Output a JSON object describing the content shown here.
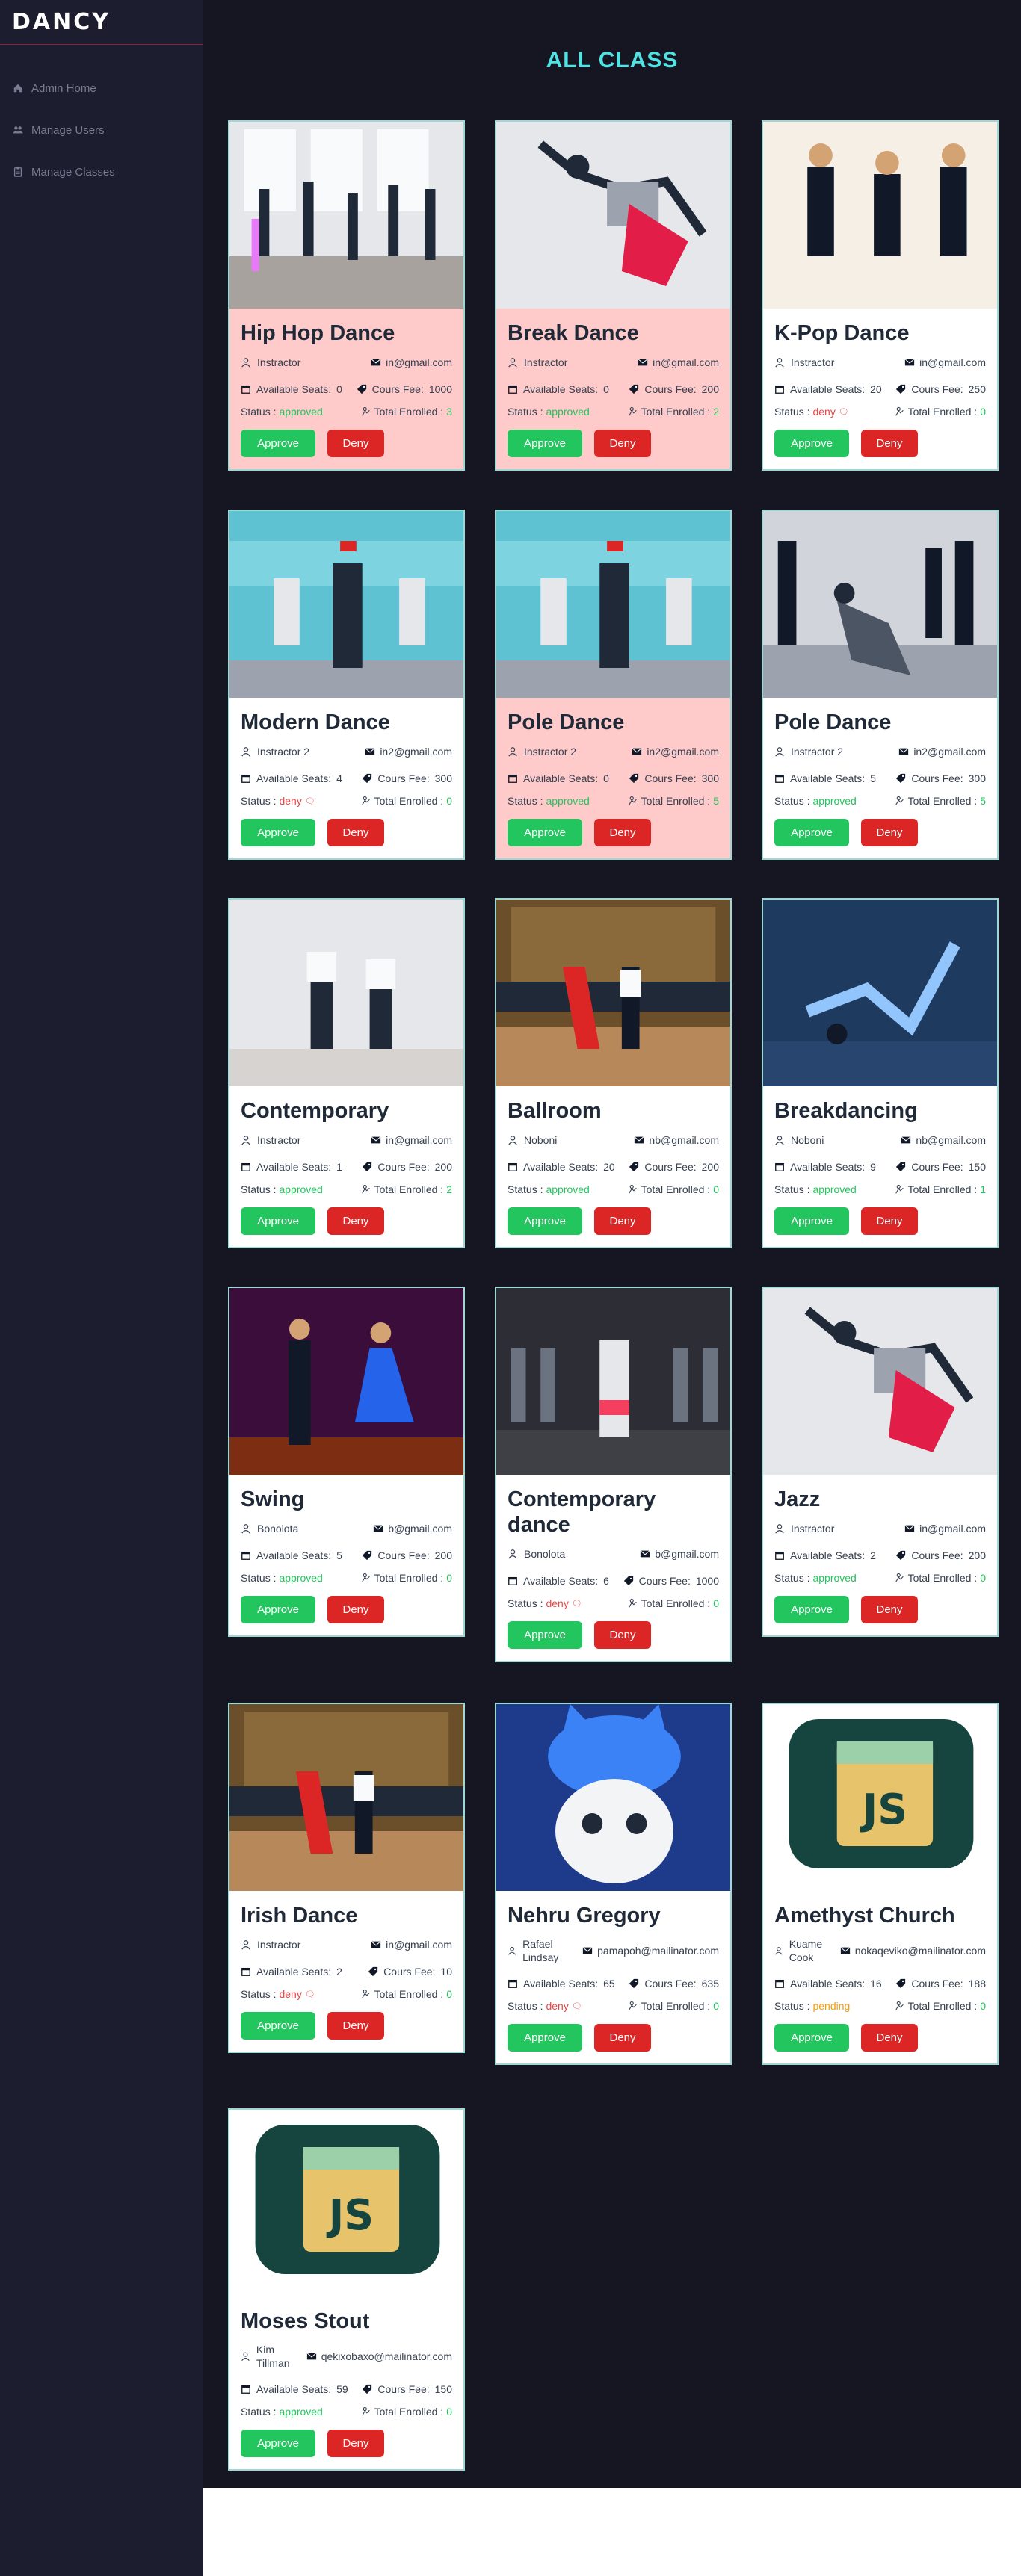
{
  "brand": "DANCY",
  "nav": [
    {
      "label": "Admin Home",
      "icon": "home-icon"
    },
    {
      "label": "Manage Users",
      "icon": "users-icon"
    },
    {
      "label": "Manage Classes",
      "icon": "clipboard-icon"
    }
  ],
  "page_title": "ALL CLASS",
  "labels": {
    "seats": "Available Seats: ",
    "fee": "Cours Fee: ",
    "status": "Status : ",
    "enrolled": "Total Enrolled : ",
    "approve": "Approve",
    "deny": "Deny"
  },
  "classes": [
    {
      "name": "Hip Hop Dance",
      "instructor": "Instractor",
      "email": "in@gmail.com",
      "seats": "0",
      "fee": "1000",
      "status": "approved",
      "enrolled": "3",
      "bg": "pink",
      "img": "studio-group"
    },
    {
      "name": "Break Dance",
      "instructor": "Instractor",
      "email": "in@gmail.com",
      "seats": "0",
      "fee": "200",
      "status": "approved",
      "enrolled": "2",
      "bg": "pink",
      "img": "solo-red"
    },
    {
      "name": "K-Pop Dance",
      "instructor": "Instractor",
      "email": "in@gmail.com",
      "seats": "20",
      "fee": "250",
      "status": "deny",
      "enrolled": "0",
      "bg": "white",
      "img": "ballet"
    },
    {
      "name": "Modern Dance",
      "instructor": "Instractor 2",
      "email": "in2@gmail.com",
      "seats": "4",
      "fee": "300",
      "status": "deny",
      "enrolled": "0",
      "bg": "white",
      "img": "crew"
    },
    {
      "name": "Pole Dance",
      "instructor": "Instractor 2",
      "email": "in2@gmail.com",
      "seats": "0",
      "fee": "300",
      "status": "approved",
      "enrolled": "5",
      "bg": "pink",
      "img": "crew"
    },
    {
      "name": "Pole Dance",
      "instructor": "Instractor 2",
      "email": "in2@gmail.com",
      "seats": "5",
      "fee": "300",
      "status": "approved",
      "enrolled": "5",
      "bg": "white",
      "img": "street"
    },
    {
      "name": "Contemporary",
      "instructor": "Instractor",
      "email": "in@gmail.com",
      "seats": "1",
      "fee": "200",
      "status": "approved",
      "enrolled": "2",
      "bg": "white",
      "img": "duo-studio"
    },
    {
      "name": "Ballroom",
      "instructor": "Noboni",
      "email": "nb@gmail.com",
      "seats": "20",
      "fee": "200",
      "status": "approved",
      "enrolled": "0",
      "bg": "white",
      "img": "ballroom"
    },
    {
      "name": "Breakdancing",
      "instructor": "Noboni",
      "email": "nb@gmail.com",
      "seats": "9",
      "fee": "150",
      "status": "approved",
      "enrolled": "1",
      "bg": "white",
      "img": "bboy"
    },
    {
      "name": "Swing",
      "instructor": "Bonolota",
      "email": "b@gmail.com",
      "seats": "5",
      "fee": "200",
      "status": "approved",
      "enrolled": "0",
      "bg": "white",
      "img": "swing"
    },
    {
      "name": "Contemporary dance",
      "instructor": "Bonolota",
      "email": "b@gmail.com",
      "seats": "6",
      "fee": "1000",
      "status": "deny",
      "enrolled": "0",
      "bg": "white",
      "img": "class-hall"
    },
    {
      "name": "Jazz",
      "instructor": "Instractor",
      "email": "in@gmail.com",
      "seats": "2",
      "fee": "200",
      "status": "approved",
      "enrolled": "0",
      "bg": "white",
      "img": "solo-red"
    },
    {
      "name": "Irish Dance",
      "instructor": "Instractor",
      "email": "in@gmail.com",
      "seats": "2",
      "fee": "10",
      "status": "deny",
      "enrolled": "0",
      "bg": "white",
      "img": "ballroom"
    },
    {
      "name": "Nehru Gregory",
      "instructor": "Rafael Lindsay",
      "email": "pamapoh@mailinator.com",
      "seats": "65",
      "fee": "635",
      "status": "deny",
      "enrolled": "0",
      "bg": "white",
      "img": "cat"
    },
    {
      "name": "Amethyst Church",
      "instructor": "Kuame Cook",
      "email": "nokaqeviko@mailinator.com",
      "seats": "16",
      "fee": "188",
      "status": "pending",
      "enrolled": "0",
      "bg": "white",
      "img": "js-logo"
    },
    {
      "name": "Moses Stout",
      "instructor": "Kim Tillman",
      "email": "qekixobaxo@mailinator.com",
      "seats": "59",
      "fee": "150",
      "status": "approved",
      "enrolled": "0",
      "bg": "white",
      "img": "js-logo"
    }
  ],
  "colors": {
    "accent": "#4fe3e3",
    "sidebar": "#1c1d2e",
    "main": "#161622",
    "approve": "#22c55e",
    "deny": "#dc2626",
    "pink_card": "#fecaca"
  }
}
